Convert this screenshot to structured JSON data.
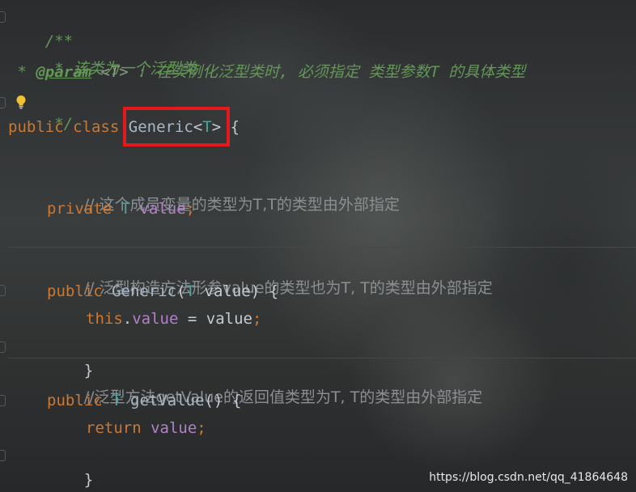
{
  "code": {
    "doc_open": "/**",
    "doc_line1": " * 该类为一个泛型类",
    "doc_line2_star": " * ",
    "doc_line2_tag": "@param",
    "doc_line2_type": " <T>",
    "doc_line2_text": " : 在实例化泛型类时, 必须指定 类型参数T 的具体类型",
    "doc_close": " */",
    "class_decl": {
      "kw1": "public",
      "kw2": "class",
      "name": "Generic",
      "lt": "<",
      "tparam": "T",
      "gt": ">",
      "brace": "{"
    },
    "comment1": "// 这个成员变量的类型为T,T的类型由外部指定",
    "field_decl": {
      "kw": "private",
      "type": "T",
      "name": "value",
      "semi": ";"
    },
    "comment2": "// 泛型构造方法形参value的类型也为T, T的类型由外部指定",
    "ctor_decl": {
      "kw": "public",
      "name": "Generic",
      "paren_open": "(",
      "type": "T",
      "param": "value",
      "paren_close": ")",
      "brace": "{"
    },
    "ctor_body": {
      "this": "this",
      "dot": ".",
      "field": "value",
      "assign": " = ",
      "param": "value",
      "semi": ";"
    },
    "ctor_close": "}",
    "comment3": "//泛型方法getValue的返回值类型为T, T的类型由外部指定",
    "method_decl": {
      "kw": "public",
      "type": "T",
      "name": "getValue",
      "parens": "()",
      "brace": "{"
    },
    "method_body": {
      "kw": "return",
      "field": "value",
      "semi": ";"
    },
    "method_close": "}",
    "class_close": "}"
  },
  "icons": {
    "bulb": "lightbulb-icon"
  },
  "colors": {
    "highlight_box": "#e5181c",
    "keyword": "#cc7832",
    "type_param": "#4ea2a0",
    "field": "#b281c8",
    "doc_comment": "#629755"
  },
  "watermark": "https://blog.csdn.net/qq_41864648"
}
